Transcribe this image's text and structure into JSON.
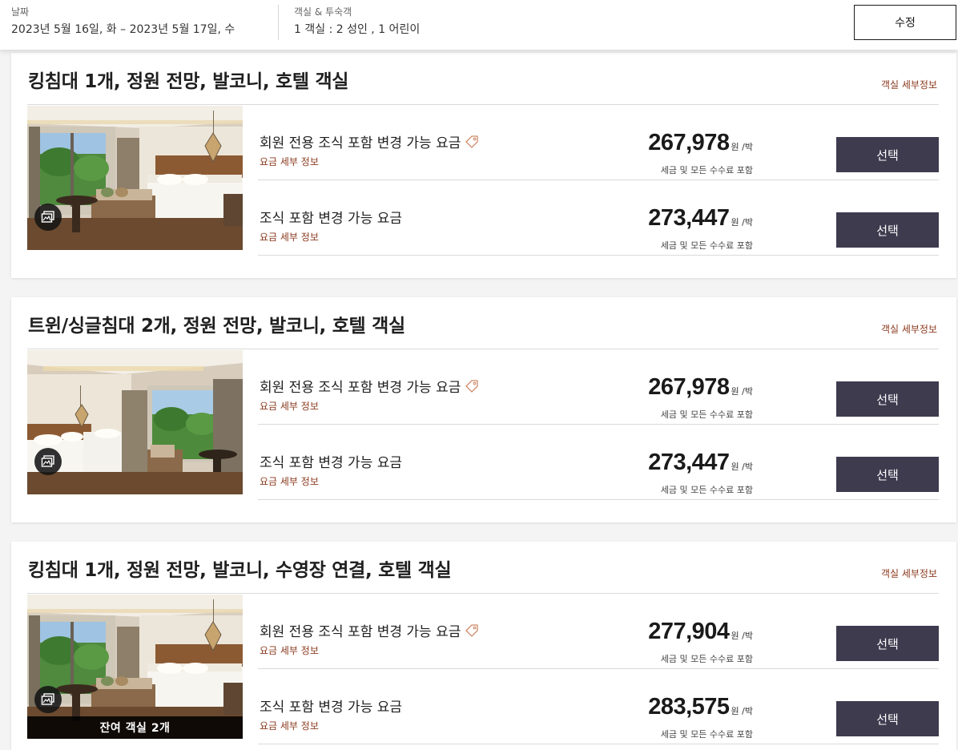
{
  "search": {
    "date_label": "날짜",
    "date_value": "2023년 5월 16일, 화 – 2023년 5월 17일, 수",
    "guests_label": "객실 & 투숙객",
    "guests_value": "1 객실 : 2 성인 , 1 어린이",
    "edit_label": "수정"
  },
  "colors": {
    "accent_link": "#8b3a1e",
    "button_bg": "#3e3b4f"
  },
  "rooms": [
    {
      "title": "킹침대 1개, 정원 전망, 발코니, 호텔 객실",
      "detail_link": "객실 세부정보",
      "image": "king-room-photo",
      "rates": [
        {
          "name": "회원 전용 조식 포함 변경 가능 요금",
          "has_tag": true,
          "details": "요금 세부 정보",
          "price": "267,978",
          "unit": "원 /박",
          "tax": "세금 및 모든 수수료 포함",
          "button": "선택"
        },
        {
          "name": "조식 포함 변경 가능 요금",
          "has_tag": false,
          "details": "요금 세부 정보",
          "price": "273,447",
          "unit": "원 /박",
          "tax": "세금 및 모든 수수료 포함",
          "button": "선택"
        }
      ]
    },
    {
      "title": "트윈/싱글침대 2개, 정원 전망, 발코니, 호텔 객실",
      "detail_link": "객실 세부정보",
      "image": "twin-room-photo",
      "rates": [
        {
          "name": "회원 전용 조식 포함 변경 가능 요금",
          "has_tag": true,
          "details": "요금 세부 정보",
          "price": "267,978",
          "unit": "원 /박",
          "tax": "세금 및 모든 수수료 포함",
          "button": "선택"
        },
        {
          "name": "조식 포함 변경 가능 요금",
          "has_tag": false,
          "details": "요금 세부 정보",
          "price": "273,447",
          "unit": "원 /박",
          "tax": "세금 및 모든 수수료 포함",
          "button": "선택"
        }
      ]
    },
    {
      "title": "킹침대 1개, 정원 전망, 발코니, 수영장 연결, 호텔 객실",
      "detail_link": "객실 세부정보",
      "image": "king-room-photo",
      "remaining": "잔여 객실 2개",
      "rates": [
        {
          "name": "회원 전용 조식 포함 변경 가능 요금",
          "has_tag": true,
          "details": "요금 세부 정보",
          "price": "277,904",
          "unit": "원 /박",
          "tax": "세금 및 모든 수수료 포함",
          "button": "선택"
        },
        {
          "name": "조식 포함 변경 가능 요금",
          "has_tag": false,
          "details": "요금 세부 정보",
          "price": "283,575",
          "unit": "원 /박",
          "tax": "세금 및 모든 수수료 포함",
          "button": "선택"
        }
      ]
    }
  ]
}
